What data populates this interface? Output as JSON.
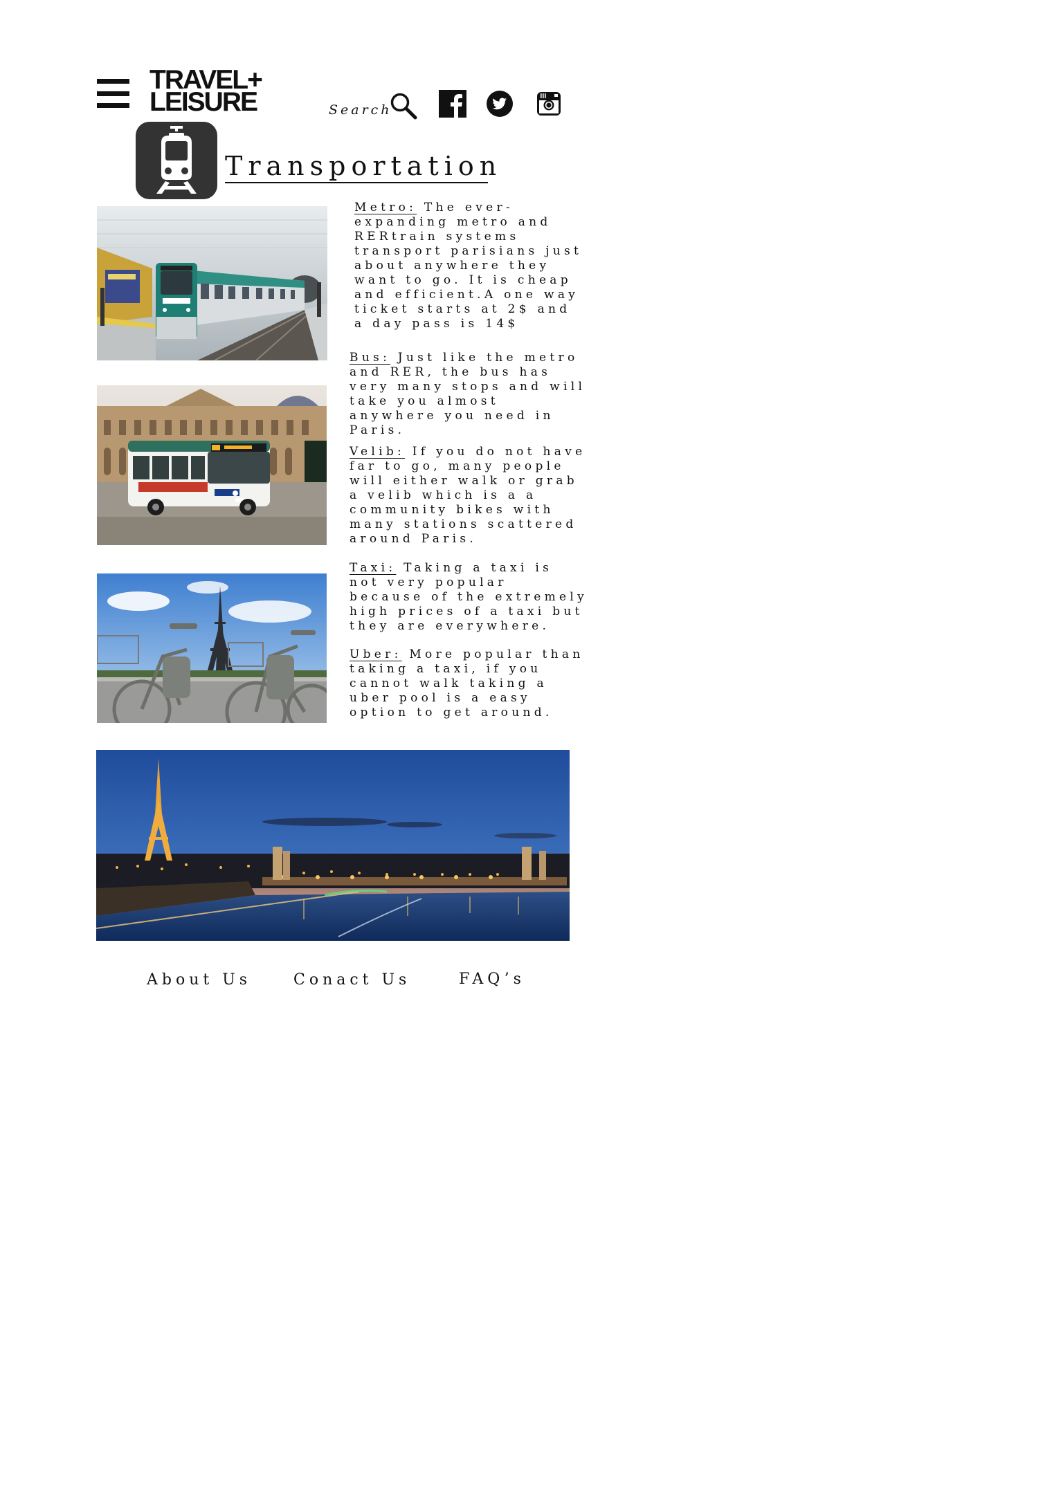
{
  "header": {
    "logo_line1": "TRAVEL+",
    "logo_line2": "LEISURE",
    "search_label": "Search",
    "icons": [
      "menu-icon",
      "search-icon",
      "facebook-icon",
      "twitter-icon",
      "instagram-icon"
    ]
  },
  "section": {
    "title": "Transportation",
    "icon": "train-icon"
  },
  "images": [
    {
      "name": "metro-train-photo",
      "subject": "Paris metro train at platform"
    },
    {
      "name": "bus-photo",
      "subject": "Paris city bus in front of the Louvre",
      "route_number": "68",
      "destination": "Montrouge"
    },
    {
      "name": "velib-bikes-photo",
      "subject": "Velib bikes with the Eiffel Tower"
    },
    {
      "name": "paris-night-photo",
      "subject": "Paris skyline at night with the Eiffel Tower and the Seine"
    }
  ],
  "transport": [
    {
      "term": "Metro:",
      "text": " The ever-expanding metro and RERtrain systems transport parisians just about anywhere they want to go. It is cheap and efficient.A one way ticket starts at 2$ and a day pass is 14$"
    },
    {
      "term": "Bus:",
      "text": " Just like the metro and RER, the bus has very many stops and will take you almost anywhere you need in Paris."
    },
    {
      "term": "Velib:",
      "text": " If you do not have far to go, many people will either walk or grab a velib which is a a community bikes with many stations scattered around Paris."
    },
    {
      "term": "Taxi:",
      "text": " Taking a taxi is not very popular because of the extremely high prices of a taxi but they are everywhere."
    },
    {
      "term": "Uber:",
      "text": " More popular than taking a taxi, if you cannot walk taking a uber pool is a easy option to get around."
    }
  ],
  "footer": {
    "about": "About Us",
    "contact": "Conact Us",
    "faq": "FAQ’s"
  },
  "colors": {
    "text": "#111111",
    "icon_tile": "#333333",
    "background": "#ffffff"
  }
}
